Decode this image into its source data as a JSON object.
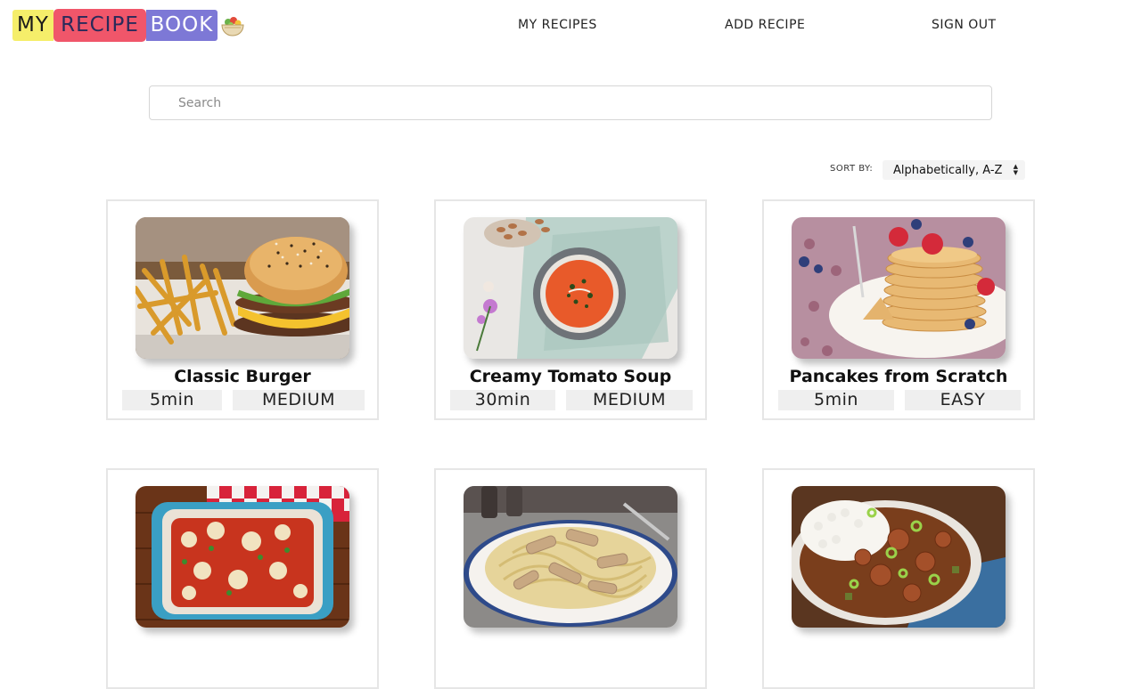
{
  "logo": {
    "my": "MY",
    "recipe": "RECIPE",
    "book": "BOOK"
  },
  "nav": {
    "my_recipes": "MY RECIPES",
    "add_recipe": "ADD RECIPE",
    "sign_out": "SIGN OUT"
  },
  "search": {
    "placeholder": "Search",
    "value": ""
  },
  "sort": {
    "label": "SORT BY:",
    "selected": "Alphabetically, A-Z"
  },
  "recipes": [
    {
      "title": "Classic Burger",
      "time": "5min",
      "difficulty": "MEDIUM",
      "image": "burger-and-fries"
    },
    {
      "title": "Creamy Tomato Soup",
      "time": "30min",
      "difficulty": "MEDIUM",
      "image": "tomato-soup-bowl"
    },
    {
      "title": "Pancakes from Scratch",
      "time": "5min",
      "difficulty": "EASY",
      "image": "pancake-stack"
    },
    {
      "title": "",
      "time": "",
      "difficulty": "",
      "image": "baked-pasta-dish"
    },
    {
      "title": "",
      "time": "",
      "difficulty": "",
      "image": "chicken-fettuccine"
    },
    {
      "title": "",
      "time": "",
      "difficulty": "",
      "image": "gumbo-with-rice"
    }
  ]
}
